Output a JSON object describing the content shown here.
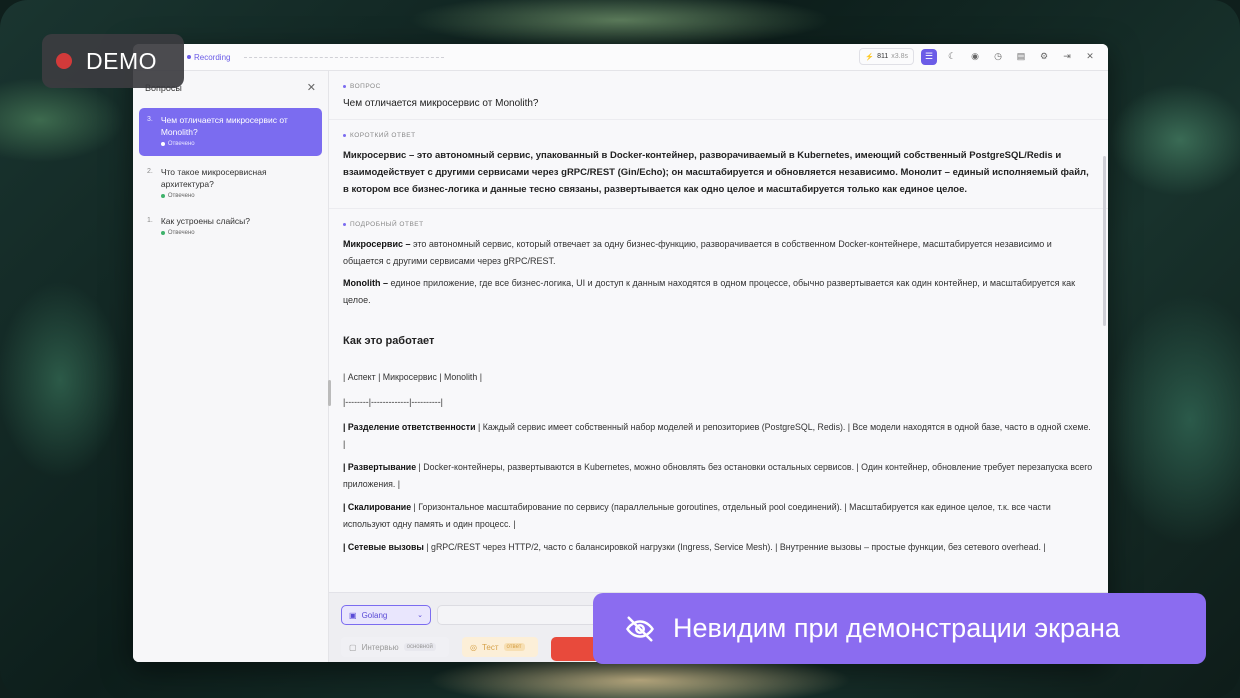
{
  "demo_badge": {
    "label": "DEMO"
  },
  "titlebar": {
    "recording_label": "Recording",
    "tokens": "811",
    "tokens_sub": "x3.8s"
  },
  "sidebar": {
    "heading": "Вопросы",
    "items": [
      {
        "num": "3.",
        "title": "Чем отличается микросервис от Monolith?",
        "status": "Отвечено"
      },
      {
        "num": "2.",
        "title": "Что такое микросервисная архитектура?",
        "status": "Отвечено"
      },
      {
        "num": "1.",
        "title": "Как устроены слайсы?",
        "status": "Отвечено"
      }
    ]
  },
  "main": {
    "question_label": "ВОПРОС",
    "question": "Чем отличается микросервис от Monolith?",
    "short_label": "КОРОТКИЙ ОТВЕТ",
    "short_answer": "Микросервис – это автономный сервис, упакованный в Docker-контейнер, разворачиваемый в Kubernetes, имеющий собственный PostgreSQL/Redis и взаимодействует с другими сервисами через gRPC/REST (Gin/Echo); он масштабируется и обновляется независимо. Монолит – единый исполняемый файл, в котором все бизнес-логика и данные тесно связаны, развертывается как одно целое и масштабируется только как единое целое.",
    "detail_label": "ПОДРОБНЫЙ ОТВЕТ",
    "detail_p1_bold": "Микросервис –",
    "detail_p1": " это автономный сервис, который отвечает за одну бизнес-функцию, разворачивается в собственном Docker-контейнере, масштабируется независимо и общается с другими сервисами через gRPC/REST.",
    "detail_p2_bold": "Monolith –",
    "detail_p2": " единое приложение, где все бизнес-логика, UI и доступ к данным находятся в одном процессе, обычно развертывается как один контейнер, и масштабируется как целое.",
    "how_title": "Как это работает",
    "table_header": "| Аспект | Микросервис | Monolith |",
    "table_sep": "|--------|-------------|----------|",
    "rows": [
      {
        "bold": "| Разделение ответственности",
        "text": " | Каждый сервис имеет собственный набор моделей и репозиториев (PostgreSQL, Redis). | Все модели находятся в одной базе, часто в одной схеме. |"
      },
      {
        "bold": "| Развертывание",
        "text": " | Docker-контейнеры, развертываются в Kubernetes, можно обновлять без остановки остальных сервисов. | Один контейнер, обновление требует перезапуска всего приложения. |"
      },
      {
        "bold": "| Скалирование",
        "text": " | Горизонтальное масштабирование по сервису (параллельные goroutines, отдельный pool соединений). | Масштабируется как единое целое, т.к. все части используют одну память и один процесс. |"
      },
      {
        "bold": "| Сетевые вызовы",
        "text": " | gRPC/REST через HTTP/2, часто с балансировкой нагрузки (Ingress, Service Mesh). | Внутренние вызовы – простые функции, без сетевого overhead. |"
      }
    ]
  },
  "input": {
    "language": "Golang",
    "mode_interview": "Интервью",
    "mode_interview_badge": "основной",
    "mode_test": "Тест",
    "mode_test_badge": "ответ"
  },
  "banner": {
    "text": "Невидим при демонстрации экрана"
  }
}
